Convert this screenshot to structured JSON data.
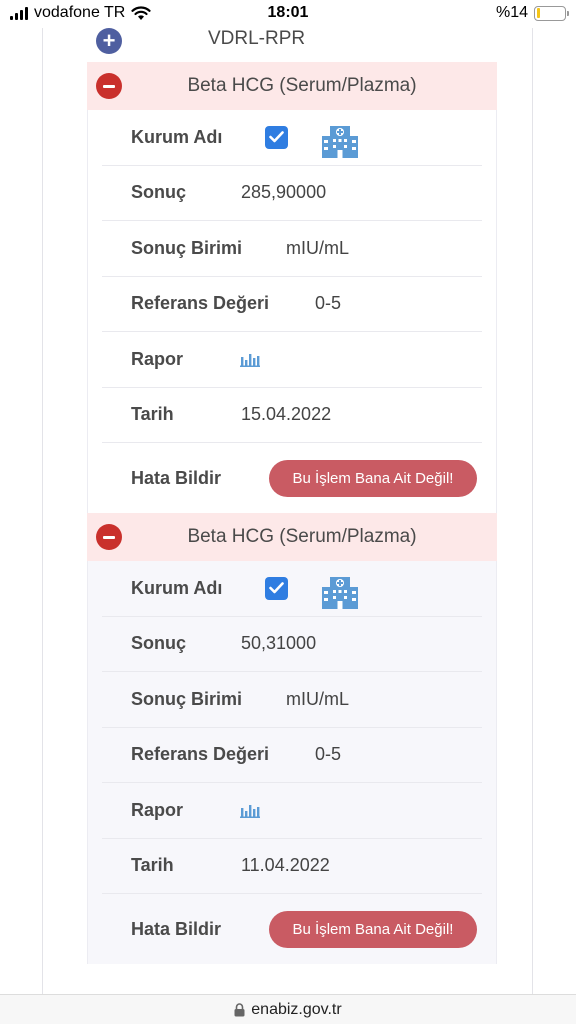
{
  "status": {
    "carrier": "vodafone TR",
    "time": "18:01",
    "battery": "%14",
    "battery_level": 0.14
  },
  "collapsed_section": {
    "title": "VDRL-RPR"
  },
  "labels": {
    "kurum": "Kurum Adı",
    "sonuc": "Sonuç",
    "birim": "Sonuç Birimi",
    "referans": "Referans Değeri",
    "rapor": "Rapor",
    "tarih": "Tarih",
    "hata": "Hata Bildir"
  },
  "results": [
    {
      "title": "Beta HCG (Serum/Plazma)",
      "sonuc": "285,90000",
      "birim": "mIU/mL",
      "referans": "0-5",
      "tarih": "15.04.2022",
      "button": "Bu İşlem Bana Ait Değil!"
    },
    {
      "title": "Beta HCG (Serum/Plazma)",
      "sonuc": "50,31000",
      "birim": "mIU/mL",
      "referans": "0-5",
      "tarih": "11.04.2022",
      "button": "Bu İşlem Bana Ait Değil!"
    }
  ],
  "url": "enabiz.gov.tr",
  "colors": {
    "header_bg": "#fde8e8",
    "minus_toggle": "#c9302c",
    "plus_toggle": "#4f5fa0",
    "checkbox": "#2f7de1",
    "error_button": "#c95b63"
  }
}
